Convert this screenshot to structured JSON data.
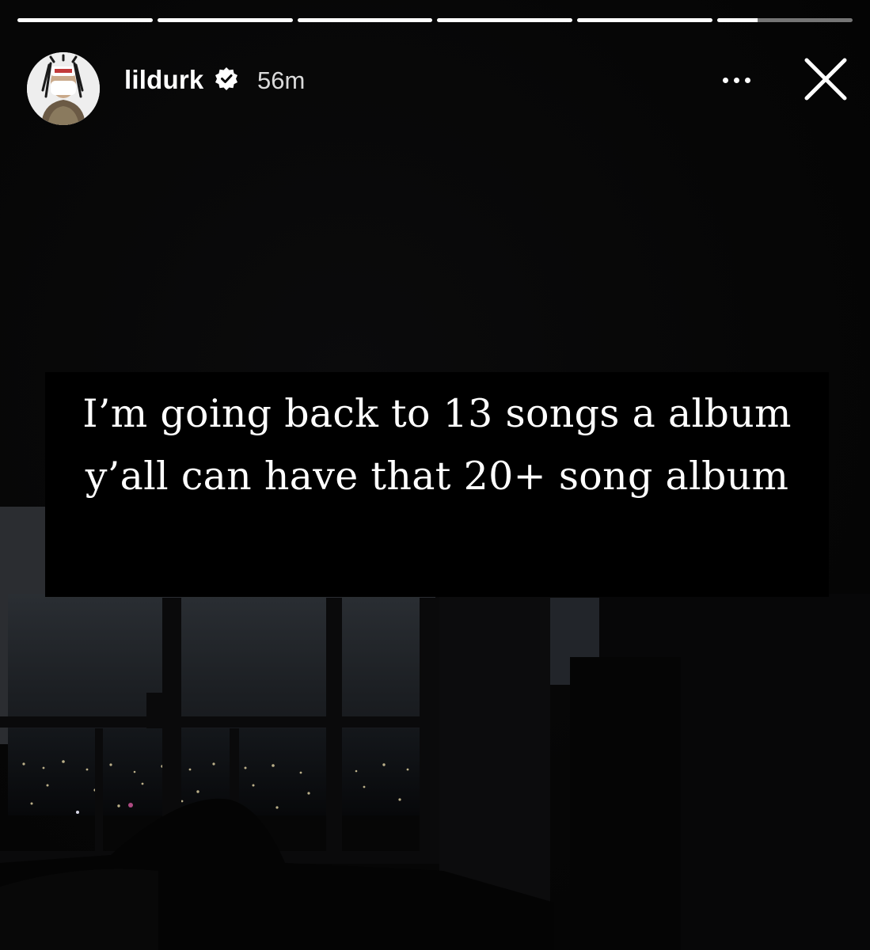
{
  "story": {
    "progress": [
      1,
      1,
      1,
      1,
      1,
      0.3
    ],
    "account": {
      "username": "lildurk",
      "verified": true,
      "time_ago": "56m"
    },
    "caption": "I’m going back to 13 songs a album y’all can have that 20+ song album",
    "icons": {
      "verified": "verified-badge-icon",
      "more": "more-options-icon",
      "close": "close-icon"
    }
  }
}
